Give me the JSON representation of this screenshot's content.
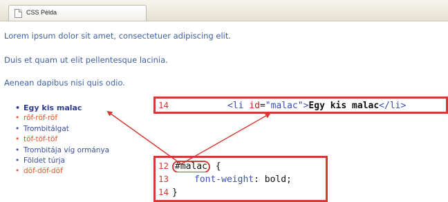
{
  "browser": {
    "tab_title": "CSS Példa"
  },
  "paragraphs": [
    "Lorem ipsum dolor sit amet, consectetuer adipiscing elit.",
    "Duis et quam ut elit pellentesque lacinia.",
    "Aenean dapibus nisi quis odio."
  ],
  "list_items": [
    {
      "label": "Egy kis malac",
      "color": "blue",
      "bold": true
    },
    {
      "label": "röf-röf-röf",
      "color": "red",
      "bold": false
    },
    {
      "label": "Trombitálgat",
      "color": "blue",
      "bold": false
    },
    {
      "label": "töf-töf-töf",
      "color": "red",
      "bold": false
    },
    {
      "label": "Trombitája víg ormánya",
      "color": "blue",
      "bold": false
    },
    {
      "label": "Földet túrja",
      "color": "blue",
      "bold": false
    },
    {
      "label": "döf-döf-döf",
      "color": "red",
      "bold": false
    }
  ],
  "html_code": {
    "line_number": "14",
    "tag_open_start": "<li",
    "attr_name": "id",
    "attr_eq": "=",
    "attr_value": "\"malac\"",
    "tag_open_end": ">",
    "text": "Egy kis malac",
    "tag_close": "</li>"
  },
  "css_code": {
    "lines": [
      {
        "number": "12",
        "selector": "#malac",
        "rest": " {"
      },
      {
        "number": "13",
        "property": "font-weight",
        "value": ": bold;"
      },
      {
        "number": "14",
        "rest": "}"
      }
    ]
  },
  "colors": {
    "highlight": "#d23a34",
    "link_blue": "#3e5fa6",
    "list_red": "#e0552c"
  }
}
